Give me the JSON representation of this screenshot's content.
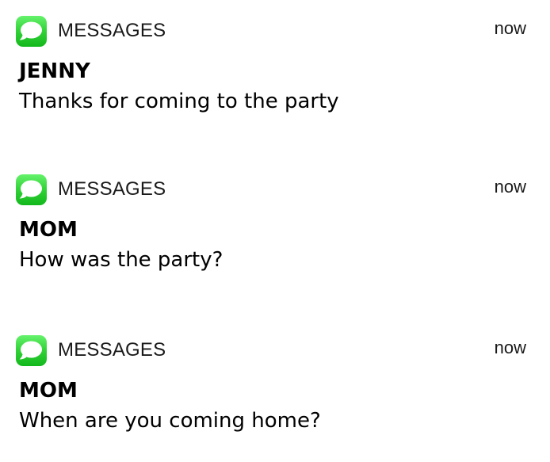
{
  "notifications": [
    {
      "app_icon": "messages-icon",
      "app_name": "MESSAGES",
      "time": "now",
      "sender": "JENNY",
      "message": "Thanks for coming to the party"
    },
    {
      "app_icon": "messages-icon",
      "app_name": "MESSAGES",
      "time": "now",
      "sender": "MOM",
      "message": "How was the party?"
    },
    {
      "app_icon": "messages-icon",
      "app_name": "MESSAGES",
      "time": "now",
      "sender": "MOM",
      "message": "When are you coming home?"
    }
  ],
  "colors": {
    "icon_green": "#35d43b",
    "text": "#000000"
  }
}
